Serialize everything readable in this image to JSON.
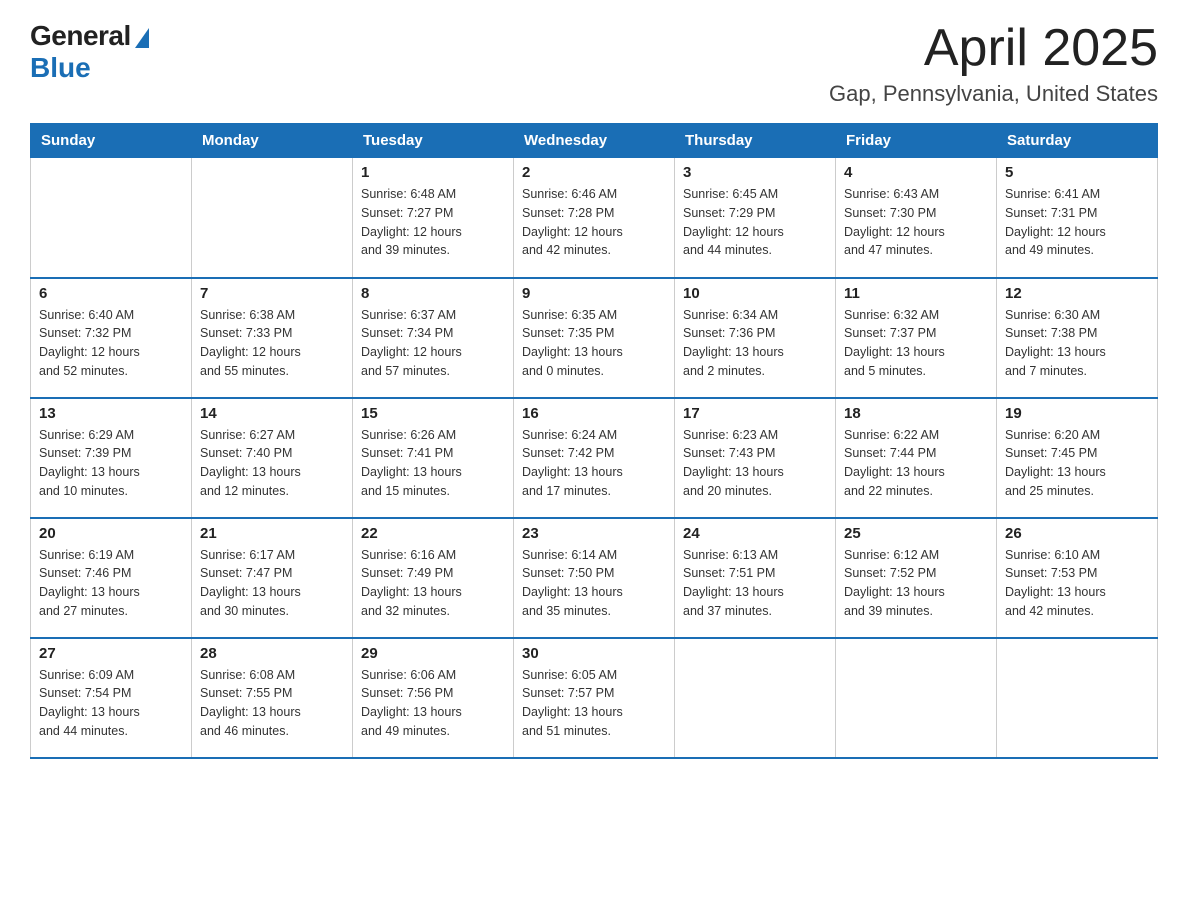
{
  "logo": {
    "general": "General",
    "blue": "Blue"
  },
  "title": "April 2025",
  "subtitle": "Gap, Pennsylvania, United States",
  "days_of_week": [
    "Sunday",
    "Monday",
    "Tuesday",
    "Wednesday",
    "Thursday",
    "Friday",
    "Saturday"
  ],
  "weeks": [
    [
      {
        "day": "",
        "info": ""
      },
      {
        "day": "",
        "info": ""
      },
      {
        "day": "1",
        "info": "Sunrise: 6:48 AM\nSunset: 7:27 PM\nDaylight: 12 hours\nand 39 minutes."
      },
      {
        "day": "2",
        "info": "Sunrise: 6:46 AM\nSunset: 7:28 PM\nDaylight: 12 hours\nand 42 minutes."
      },
      {
        "day": "3",
        "info": "Sunrise: 6:45 AM\nSunset: 7:29 PM\nDaylight: 12 hours\nand 44 minutes."
      },
      {
        "day": "4",
        "info": "Sunrise: 6:43 AM\nSunset: 7:30 PM\nDaylight: 12 hours\nand 47 minutes."
      },
      {
        "day": "5",
        "info": "Sunrise: 6:41 AM\nSunset: 7:31 PM\nDaylight: 12 hours\nand 49 minutes."
      }
    ],
    [
      {
        "day": "6",
        "info": "Sunrise: 6:40 AM\nSunset: 7:32 PM\nDaylight: 12 hours\nand 52 minutes."
      },
      {
        "day": "7",
        "info": "Sunrise: 6:38 AM\nSunset: 7:33 PM\nDaylight: 12 hours\nand 55 minutes."
      },
      {
        "day": "8",
        "info": "Sunrise: 6:37 AM\nSunset: 7:34 PM\nDaylight: 12 hours\nand 57 minutes."
      },
      {
        "day": "9",
        "info": "Sunrise: 6:35 AM\nSunset: 7:35 PM\nDaylight: 13 hours\nand 0 minutes."
      },
      {
        "day": "10",
        "info": "Sunrise: 6:34 AM\nSunset: 7:36 PM\nDaylight: 13 hours\nand 2 minutes."
      },
      {
        "day": "11",
        "info": "Sunrise: 6:32 AM\nSunset: 7:37 PM\nDaylight: 13 hours\nand 5 minutes."
      },
      {
        "day": "12",
        "info": "Sunrise: 6:30 AM\nSunset: 7:38 PM\nDaylight: 13 hours\nand 7 minutes."
      }
    ],
    [
      {
        "day": "13",
        "info": "Sunrise: 6:29 AM\nSunset: 7:39 PM\nDaylight: 13 hours\nand 10 minutes."
      },
      {
        "day": "14",
        "info": "Sunrise: 6:27 AM\nSunset: 7:40 PM\nDaylight: 13 hours\nand 12 minutes."
      },
      {
        "day": "15",
        "info": "Sunrise: 6:26 AM\nSunset: 7:41 PM\nDaylight: 13 hours\nand 15 minutes."
      },
      {
        "day": "16",
        "info": "Sunrise: 6:24 AM\nSunset: 7:42 PM\nDaylight: 13 hours\nand 17 minutes."
      },
      {
        "day": "17",
        "info": "Sunrise: 6:23 AM\nSunset: 7:43 PM\nDaylight: 13 hours\nand 20 minutes."
      },
      {
        "day": "18",
        "info": "Sunrise: 6:22 AM\nSunset: 7:44 PM\nDaylight: 13 hours\nand 22 minutes."
      },
      {
        "day": "19",
        "info": "Sunrise: 6:20 AM\nSunset: 7:45 PM\nDaylight: 13 hours\nand 25 minutes."
      }
    ],
    [
      {
        "day": "20",
        "info": "Sunrise: 6:19 AM\nSunset: 7:46 PM\nDaylight: 13 hours\nand 27 minutes."
      },
      {
        "day": "21",
        "info": "Sunrise: 6:17 AM\nSunset: 7:47 PM\nDaylight: 13 hours\nand 30 minutes."
      },
      {
        "day": "22",
        "info": "Sunrise: 6:16 AM\nSunset: 7:49 PM\nDaylight: 13 hours\nand 32 minutes."
      },
      {
        "day": "23",
        "info": "Sunrise: 6:14 AM\nSunset: 7:50 PM\nDaylight: 13 hours\nand 35 minutes."
      },
      {
        "day": "24",
        "info": "Sunrise: 6:13 AM\nSunset: 7:51 PM\nDaylight: 13 hours\nand 37 minutes."
      },
      {
        "day": "25",
        "info": "Sunrise: 6:12 AM\nSunset: 7:52 PM\nDaylight: 13 hours\nand 39 minutes."
      },
      {
        "day": "26",
        "info": "Sunrise: 6:10 AM\nSunset: 7:53 PM\nDaylight: 13 hours\nand 42 minutes."
      }
    ],
    [
      {
        "day": "27",
        "info": "Sunrise: 6:09 AM\nSunset: 7:54 PM\nDaylight: 13 hours\nand 44 minutes."
      },
      {
        "day": "28",
        "info": "Sunrise: 6:08 AM\nSunset: 7:55 PM\nDaylight: 13 hours\nand 46 minutes."
      },
      {
        "day": "29",
        "info": "Sunrise: 6:06 AM\nSunset: 7:56 PM\nDaylight: 13 hours\nand 49 minutes."
      },
      {
        "day": "30",
        "info": "Sunrise: 6:05 AM\nSunset: 7:57 PM\nDaylight: 13 hours\nand 51 minutes."
      },
      {
        "day": "",
        "info": ""
      },
      {
        "day": "",
        "info": ""
      },
      {
        "day": "",
        "info": ""
      }
    ]
  ]
}
